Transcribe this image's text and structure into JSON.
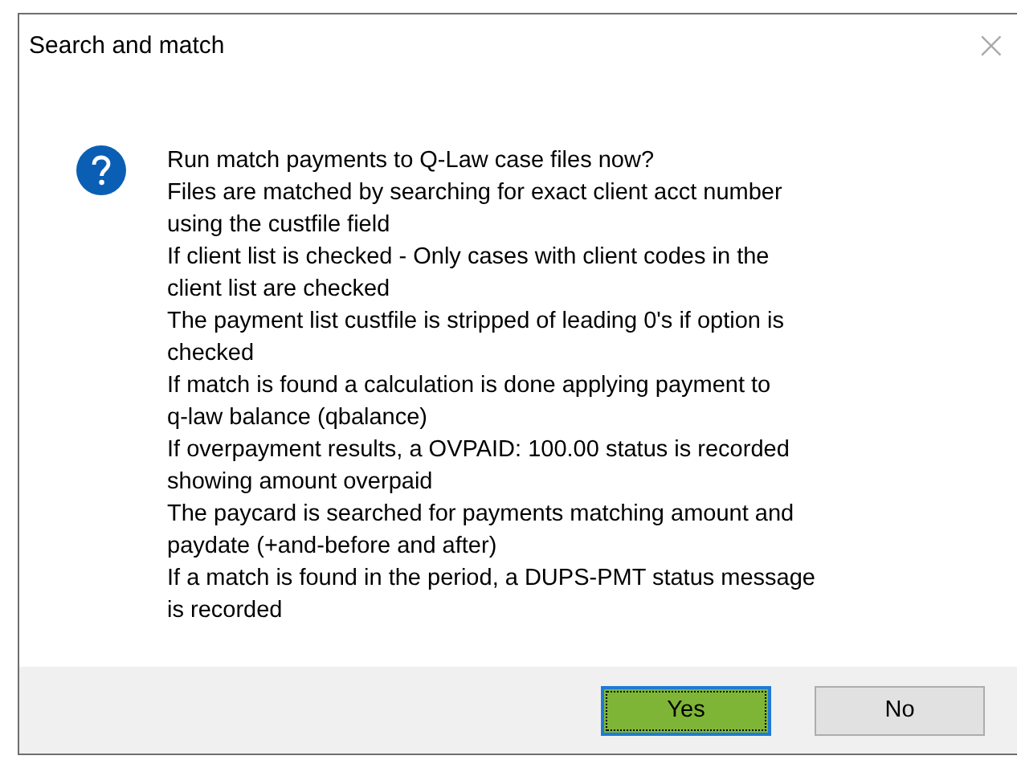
{
  "window": {
    "title": "Search and match",
    "close": "×"
  },
  "message": {
    "lines": [
      "Run match payments to Q-Law case files now?",
      "Files are matched by searching for exact client acct number",
      "using the custfile field",
      "If client list is checked - Only cases with client codes in the",
      "client list are checked",
      "The payment list custfile is stripped of leading 0's if option is",
      "checked",
      "If match is found a calculation is done applying payment to",
      "q-law balance (qbalance)",
      "If overpayment results, a OVPAID: 100.00 status is recorded",
      "showing amount overpaid",
      "The paycard is searched for payments matching amount and",
      "paydate (+and-before and after)",
      "If a match is found in the period, a DUPS-PMT status message",
      "is recorded"
    ]
  },
  "buttons": [
    {
      "label": "Yes",
      "focused": true
    },
    {
      "label": "No",
      "focused": false
    }
  ]
}
